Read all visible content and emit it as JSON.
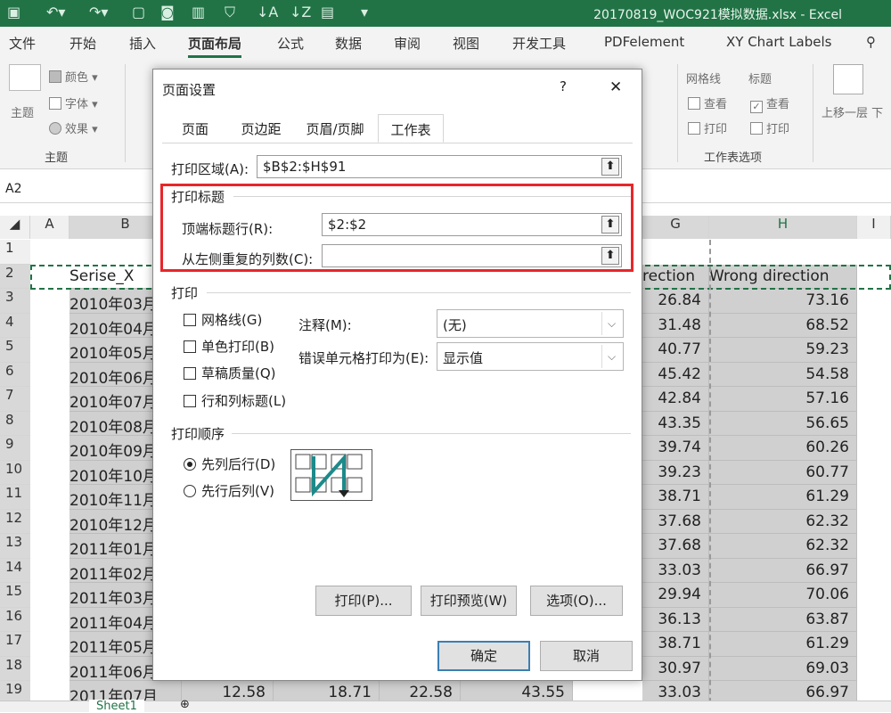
{
  "title_bar": {
    "filename": "20170819_WOC921模拟数据.xlsx - Excel"
  },
  "ribbon": {
    "tabs": [
      "文件",
      "开始",
      "插入",
      "页面布局",
      "公式",
      "数据",
      "审阅",
      "视图",
      "开发工具",
      "PDFelement",
      "XY Chart Labels"
    ],
    "active_tab": "页面布局",
    "theme_group": {
      "label": "主题",
      "items": [
        "主题",
        "颜色",
        "字体",
        "效果"
      ]
    },
    "sheet_options": {
      "label": "工作表选项",
      "gridlines": "网格线",
      "headings": "标题",
      "view": "查看",
      "print": "打印"
    },
    "arrange": {
      "bring_forward": "上移一层",
      "send_backward": "下"
    }
  },
  "name_box": "A2",
  "columns": [
    "A",
    "B",
    "G",
    "H",
    "I"
  ],
  "rows": [
    "1",
    "2",
    "3",
    "4",
    "5",
    "6",
    "7",
    "8",
    "9",
    "10",
    "11",
    "12",
    "13",
    "14",
    "15",
    "16",
    "17",
    "18",
    "19"
  ],
  "sheet": {
    "header_b": "Serise_X",
    "header_g": "rection",
    "header_h": "Wrong direction",
    "b": [
      "2010年03月",
      "2010年04月",
      "2010年05月",
      "2010年06月",
      "2010年07月",
      "2010年08月",
      "2010年09月",
      "2010年10月",
      "2010年11月",
      "2010年12月",
      "2011年01月",
      "2011年02月",
      "2011年03月",
      "2011年04月",
      "2011年05月",
      "2011年06月",
      "2011年07月"
    ],
    "g": [
      "26.84",
      "31.48",
      "40.77",
      "45.42",
      "42.84",
      "43.35",
      "39.74",
      "39.23",
      "38.71",
      "37.68",
      "37.68",
      "33.03",
      "29.94",
      "36.13",
      "38.71",
      "30.97",
      "33.03"
    ],
    "h": [
      "73.16",
      "68.52",
      "59.23",
      "54.58",
      "57.16",
      "56.65",
      "60.26",
      "60.77",
      "61.29",
      "62.32",
      "62.32",
      "66.97",
      "70.06",
      "63.87",
      "61.29",
      "69.03",
      "66.97"
    ],
    "row19_c": "12.58",
    "row19_d": "18.71",
    "row19_e": "22.58",
    "row19_f": "43.55"
  },
  "sheet_tab": "Sheet1",
  "dialog": {
    "title": "页面设置",
    "help": "?",
    "close": "✕",
    "tabs": [
      "页面",
      "页边距",
      "页眉/页脚",
      "工作表"
    ],
    "active_tab": "工作表",
    "print_area_label": "打印区域(A):",
    "print_area_value": "$B$2:$H$91",
    "print_titles_label": "打印标题",
    "rows_to_repeat_label": "顶端标题行(R):",
    "rows_to_repeat_value": "$2:$2",
    "cols_to_repeat_label": "从左侧重复的列数(C):",
    "cols_to_repeat_value": "",
    "print_section_label": "打印",
    "checkboxes": [
      "网格线(G)",
      "单色打印(B)",
      "草稿质量(Q)",
      "行和列标题(L)"
    ],
    "comments_label": "注释(M):",
    "comments_value": "(无)",
    "errors_label": "错误单元格打印为(E):",
    "errors_value": "显示值",
    "order_label": "打印顺序",
    "order_options": [
      "先列后行(D)",
      "先行后列(V)"
    ],
    "order_selected": "先列后行(D)",
    "print_button": "打印(P)...",
    "preview_button": "打印预览(W)",
    "options_button": "选项(O)...",
    "ok_button": "确定",
    "cancel_button": "取消"
  },
  "colors": {
    "excel_green": "#217346",
    "highlight_red": "#e8262a",
    "selection_gray": "#d0d0d0"
  }
}
